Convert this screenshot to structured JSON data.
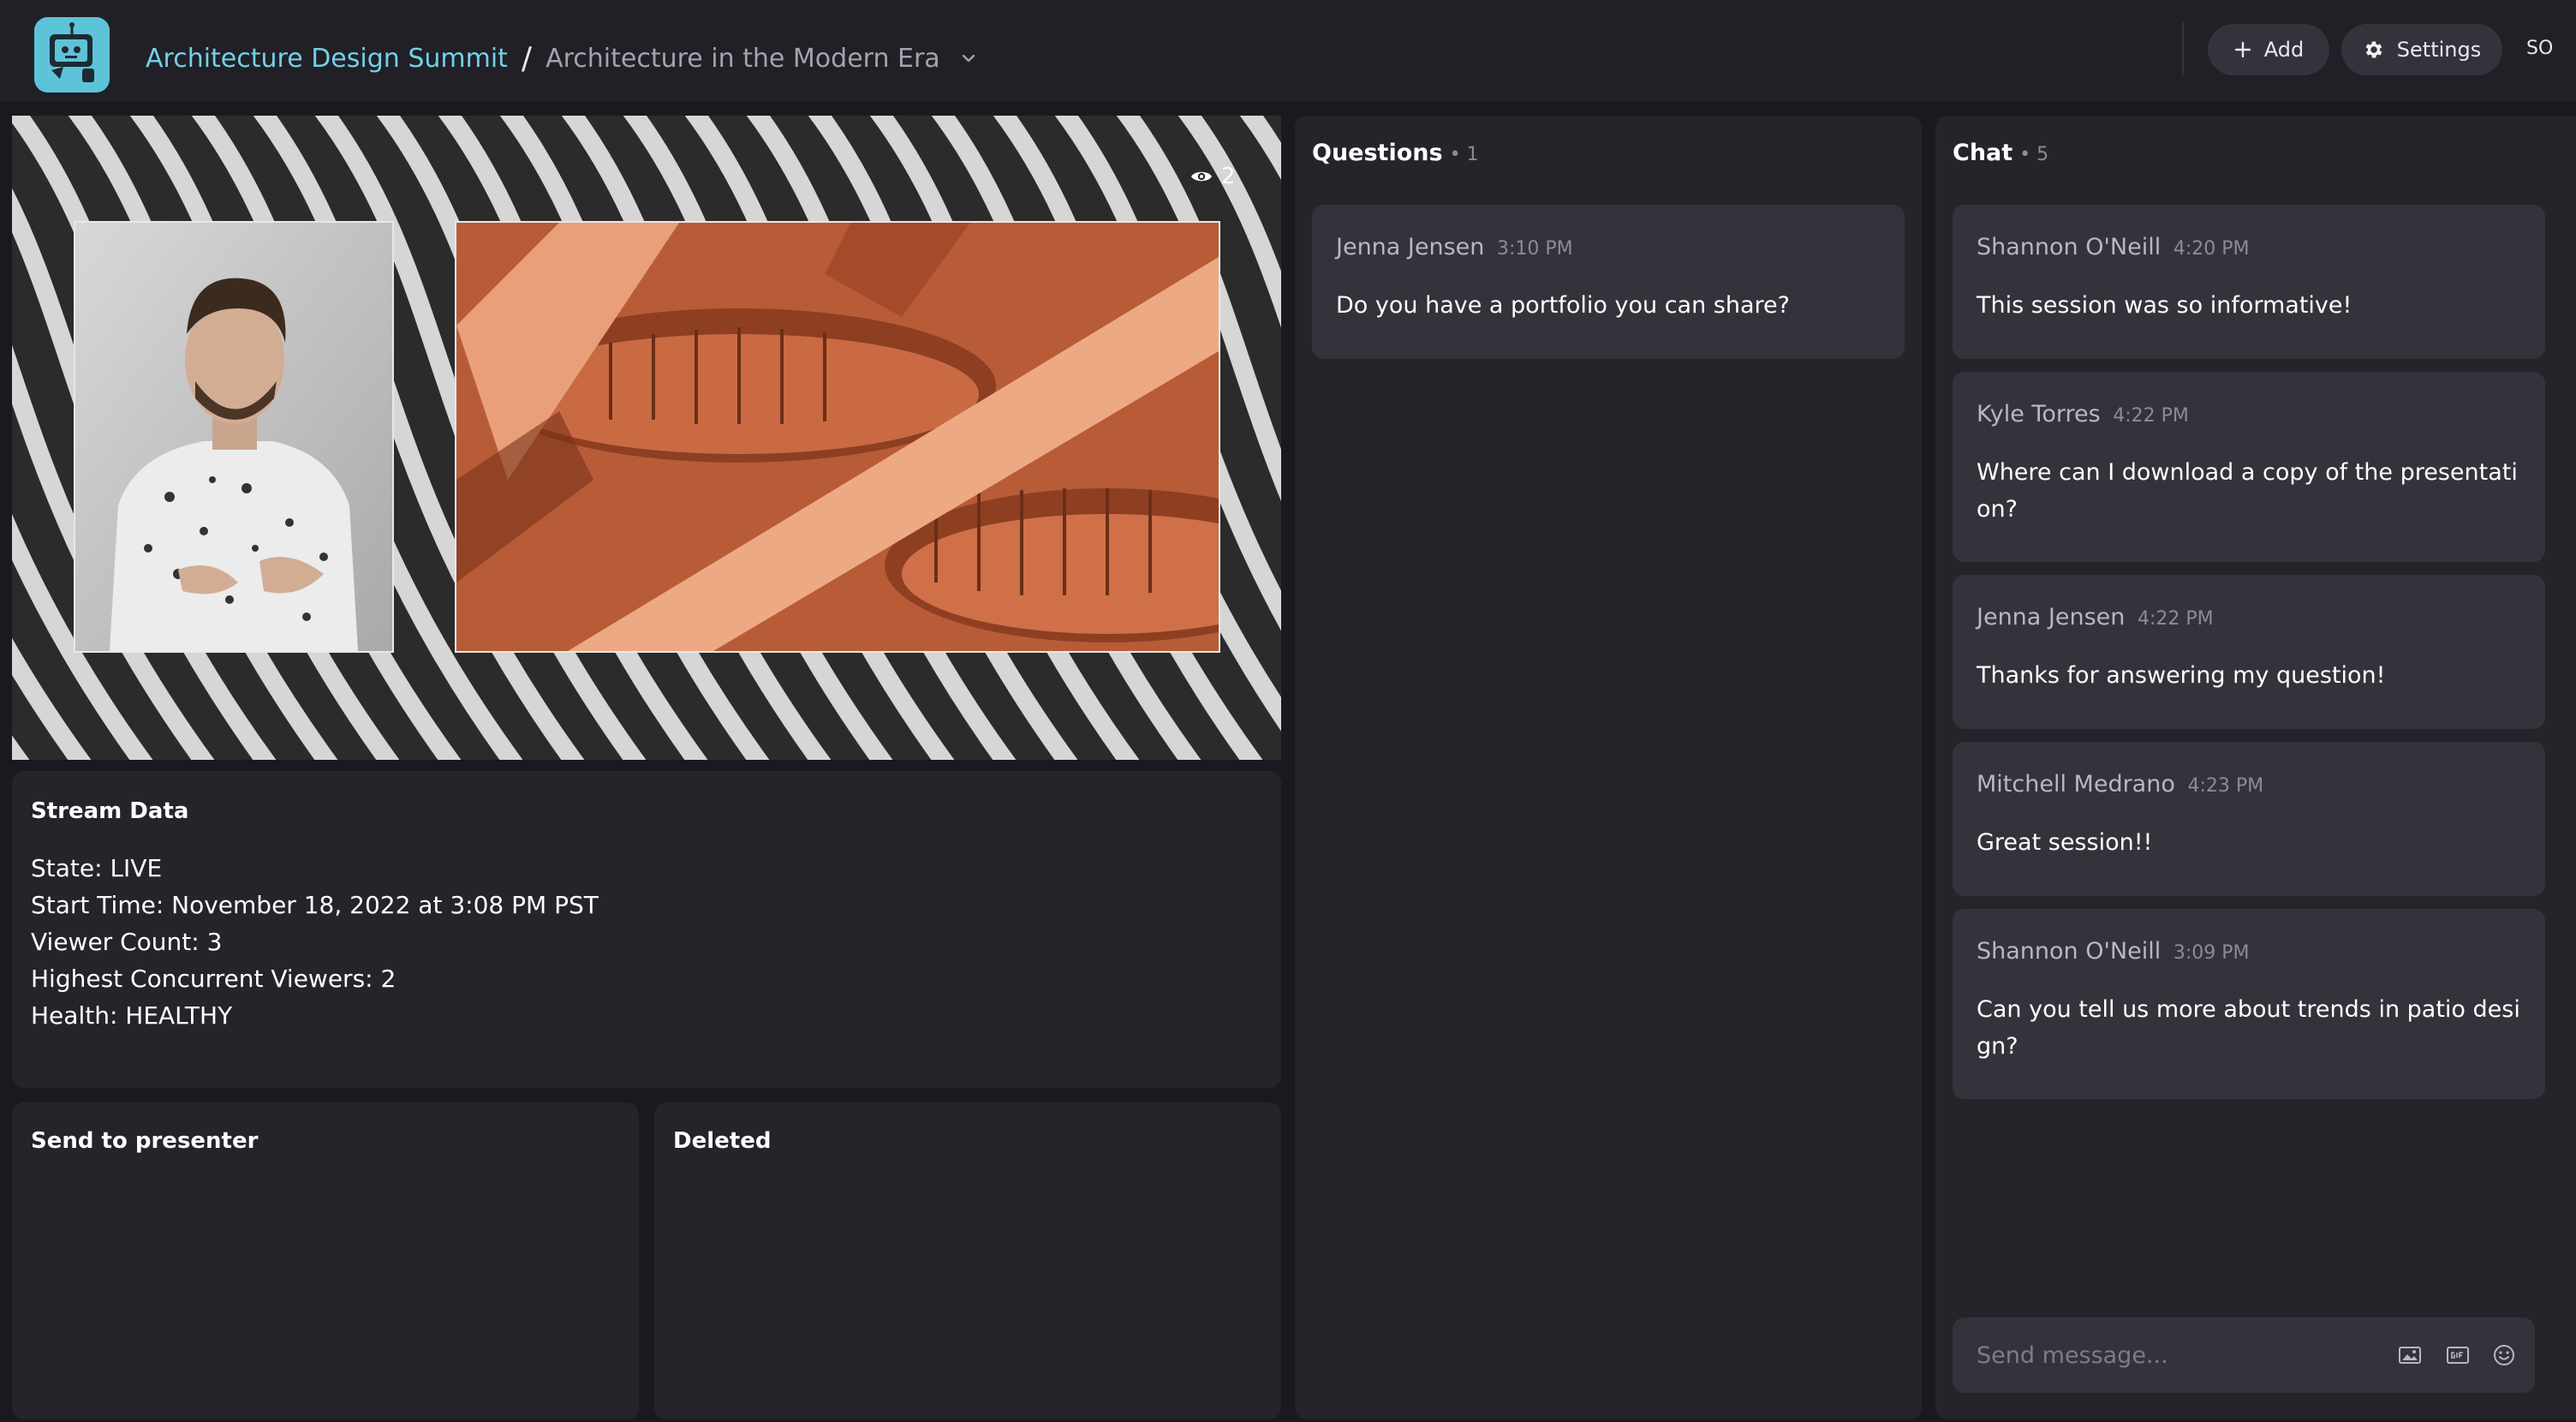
{
  "header": {
    "breadcrumb_root": "Architecture Design Summit",
    "breadcrumb_separator": "/",
    "breadcrumb_current": "Architecture in the Modern Era",
    "add_label": "Add",
    "settings_label": "Settings",
    "user_initials": "SO",
    "accent_color": "#73d0e6"
  },
  "video": {
    "viewer_count": "2"
  },
  "stream_data": {
    "title": "Stream Data",
    "state": "State: LIVE",
    "start_time": "Start Time: November 18, 2022 at 3:08 PM PST",
    "viewer_count": "Viewer Count: 3",
    "highest_concurrent": "Highest Concurrent Viewers: 2",
    "health": "Health: HEALTHY"
  },
  "send_to_presenter": {
    "title": "Send to presenter"
  },
  "deleted": {
    "title": "Deleted"
  },
  "questions": {
    "title": "Questions",
    "count": "• 1",
    "items": [
      {
        "author": "Jenna Jensen",
        "time": "3:10 PM",
        "text": "Do you have a portfolio you can share?"
      }
    ]
  },
  "chat": {
    "title": "Chat",
    "count": "• 5",
    "items": [
      {
        "author": "Shannon O'Neill",
        "time": "4:20 PM",
        "text": "This session was so informative!"
      },
      {
        "author": "Kyle Torres",
        "time": "4:22 PM",
        "text": "Where can I download a copy of the presentation?"
      },
      {
        "author": "Jenna Jensen",
        "time": "4:22 PM",
        "text": "Thanks for answering my question!"
      },
      {
        "author": "Mitchell Medrano",
        "time": "4:23 PM",
        "text": "Great session!!"
      },
      {
        "author": "Shannon O'Neill",
        "time": "3:09 PM",
        "text": "Can you tell us more about trends in patio design?"
      }
    ],
    "composer_placeholder": "Send message...",
    "composer_icons": [
      "image-icon",
      "gif-icon",
      "emoji-icon"
    ]
  }
}
